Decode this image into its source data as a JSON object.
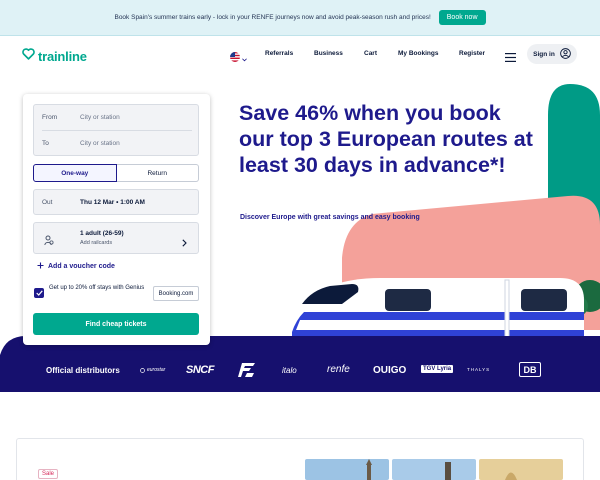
{
  "promo": {
    "text": "Book Spain's summer trains early - lock in your RENFE journeys now and avoid peak-season rush and prices!",
    "button": "Book now"
  },
  "header": {
    "brand": "trainline",
    "language_icon": "us-flag-icon",
    "nav": [
      "Referrals",
      "Business",
      "Cart",
      "My Bookings",
      "Register"
    ],
    "signin": "Sign in"
  },
  "hero": {
    "title": "Save 46% when you book our top 3 European routes at least 30 days in advance*!",
    "subtitle": "Discover Europe with great savings and easy booking"
  },
  "search": {
    "from_label": "From",
    "from_placeholder": "City or station",
    "to_label": "To",
    "to_placeholder": "City or station",
    "trip_types": [
      "One-way",
      "Return"
    ],
    "selected_trip_type": "One-way",
    "out_label": "Out",
    "out_value": "Thu 12 Mar • 1:00 AM",
    "passengers": "1 adult (26-59)",
    "railcards": "Add railcards",
    "voucher": "Add a voucher code",
    "genius_text": "Get up to 20% off stays with Genius",
    "genius_checked": true,
    "booking_partner": "Booking.com",
    "submit": "Find cheap tickets"
  },
  "distributors": {
    "label": "Official distributors",
    "brands": [
      "eurostar",
      "SNCF",
      "FS",
      "italo",
      "renfe",
      "OUIGO",
      "TGV Lyria",
      "THALYS",
      "DB"
    ]
  },
  "deals": {
    "badge": "Sale"
  },
  "colors": {
    "brand": "#00a88f",
    "navy": "#1e1a8c",
    "distributor_band": "#16106e",
    "hero_pink": "#f4a19a",
    "hero_teal": "#009b86"
  }
}
